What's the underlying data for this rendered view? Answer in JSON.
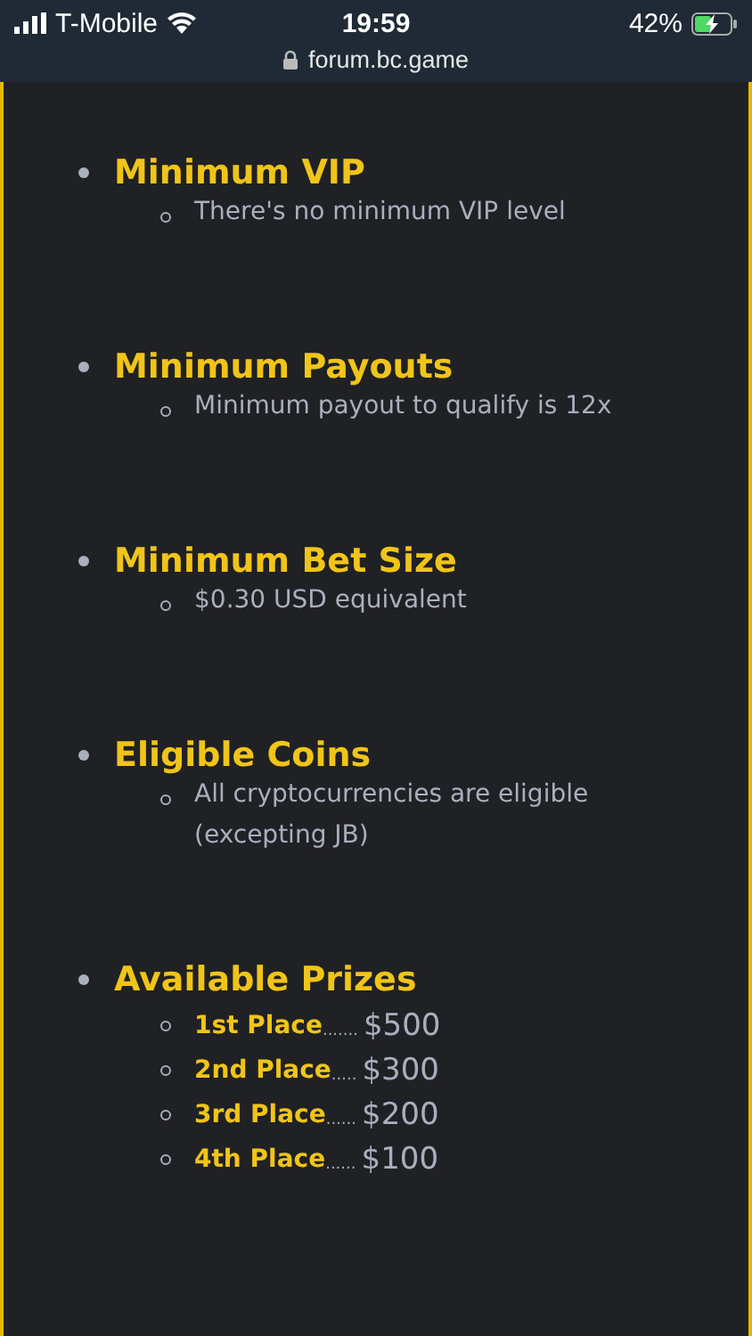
{
  "status_bar": {
    "carrier": "T-Mobile",
    "time": "19:59",
    "battery": "42%",
    "url": "forum.bc.game"
  },
  "sections": [
    {
      "title": "Minimum VIP",
      "items": [
        "There's no minimum VIP level"
      ]
    },
    {
      "title": "Minimum Payouts",
      "items": [
        "Minimum payout to qualify is 12x"
      ]
    },
    {
      "title": "Minimum Bet Size",
      "items": [
        "$0.30 USD equivalent"
      ]
    },
    {
      "title": "Eligible Coins",
      "items": [
        "All cryptocurrencies are eligible (excepting JB)"
      ]
    },
    {
      "title": "Available Prizes",
      "prizes": [
        {
          "place": "1st Place",
          "leader": ".......",
          "amount": "$500"
        },
        {
          "place": "2nd Place",
          "leader": ".....",
          "amount": "$300"
        },
        {
          "place": "3rd Place",
          "leader": "......",
          "amount": "$200"
        },
        {
          "place": "4th Place",
          "leader": "......",
          "amount": "$100"
        }
      ]
    }
  ]
}
